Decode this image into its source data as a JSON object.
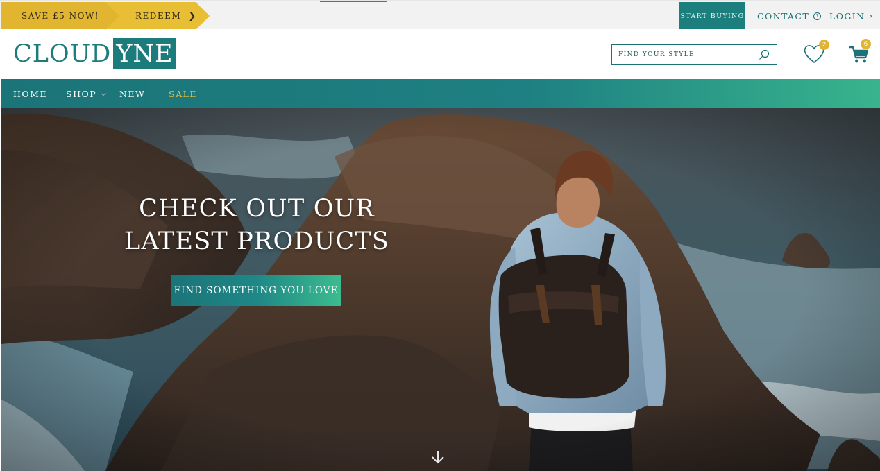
{
  "promo": {
    "save_label": "SAVE £5 NOW!",
    "redeem_label": "REDEEM",
    "redeem_icon": "chevron-right-icon"
  },
  "utility_nav": {
    "start_buying": "START BUYING",
    "contact": "CONTACT",
    "contact_icon": "question-circle-icon",
    "login": "LOGIN",
    "login_icon": "chevron-right-icon"
  },
  "header": {
    "logo_part1": "CLOUD",
    "logo_part2": "YNE",
    "search_placeholder": "FIND YOUR STYLE",
    "search_icon": "search-icon",
    "wishlist_count": "2",
    "cart_count": "6"
  },
  "nav": {
    "items": [
      {
        "label": "HOME"
      },
      {
        "label": "SHOP",
        "has_dropdown": true
      },
      {
        "label": "NEW"
      },
      {
        "label": "SALE",
        "highlight": true
      }
    ]
  },
  "hero": {
    "title_line1": "CHECK OUT OUR",
    "title_line2": "LATEST PRODUCTS",
    "cta_label": "FIND SOMETHING YOU LOVE",
    "scroll_icon": "arrow-down-icon"
  },
  "colors": {
    "brand_teal": "#1c7b7b",
    "accent_gold": "#e1b52f",
    "nav_gradient_end": "#38b48d"
  }
}
